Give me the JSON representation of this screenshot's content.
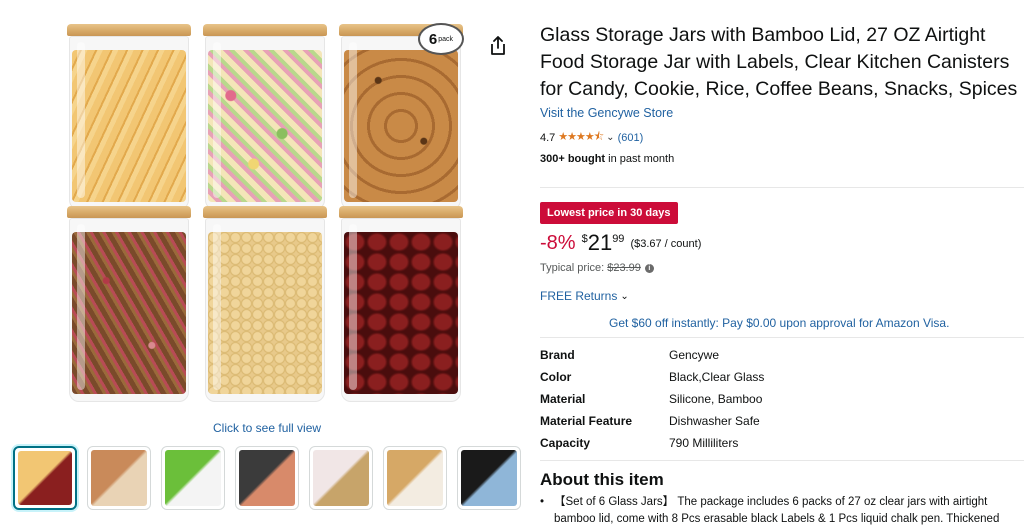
{
  "gallery": {
    "pack_badge_number": "6",
    "pack_badge_text": "pack",
    "see_full_view": "Click to see full view",
    "thumbnails": [
      {
        "name": "thumb-jars",
        "colors": [
          "#f2c673",
          "#8a1f1f"
        ]
      },
      {
        "name": "thumb-kitchen",
        "colors": [
          "#c98a5a",
          "#e9d3b5"
        ]
      },
      {
        "name": "thumb-labels",
        "colors": [
          "#6bbf3a",
          "#f4f4f4"
        ]
      },
      {
        "name": "thumb-pasta-hand",
        "colors": [
          "#3b3b3b",
          "#d88a6a"
        ]
      },
      {
        "name": "thumb-candy",
        "colors": [
          "#f1e6e6",
          "#c7a46a"
        ]
      },
      {
        "name": "thumb-lids",
        "colors": [
          "#d6a866",
          "#f3ece1"
        ]
      },
      {
        "name": "thumb-dishwasher",
        "colors": [
          "#1a1a1a",
          "#8fb6d8"
        ]
      }
    ]
  },
  "product": {
    "title": "Glass Storage Jars with Bamboo Lid, 27 OZ Airtight Food Storage Jar with Labels, Clear Kitchen Canisters for Candy, Cookie, Rice, Coffee Beans, Snacks, Spices",
    "store_link": "Visit the Gencywe Store",
    "rating": "4.7",
    "stars": "★★★★⯪",
    "rating_count": "(601)",
    "bought_bold": "300+ bought",
    "bought_rest": " in past month",
    "deal_badge": "Lowest price in 30 days",
    "discount": "-8%",
    "currency": "$",
    "price_whole": "21",
    "price_cents": "99",
    "per_count": "($3.67 / count)",
    "typical_label": "Typical price:",
    "typical_price": "$23.99",
    "free_returns": "FREE Returns",
    "promo": "Get $60 off instantly: Pay $0.00 upon approval for Amazon Visa.",
    "specs": [
      {
        "key": "Brand",
        "value": "Gencywe"
      },
      {
        "key": "Color",
        "value": "Black,Clear Glass"
      },
      {
        "key": "Material",
        "value": "Silicone, Bamboo"
      },
      {
        "key": "Material Feature",
        "value": "Dishwasher Safe"
      },
      {
        "key": "Capacity",
        "value": "790 Milliliters"
      }
    ],
    "about_heading": "About this item",
    "bullet_1": "【Set of 6 Glass Jars】 The package includes 6 packs of 27 oz clear jars with airtight bamboo lid, come with 8 Pcs erasable black Labels & 1 Pcs liquid chalk pen. Thickened"
  },
  "colors": {
    "link": "#2162a1",
    "deal_red": "#cc0c39",
    "star": "#de7921"
  }
}
